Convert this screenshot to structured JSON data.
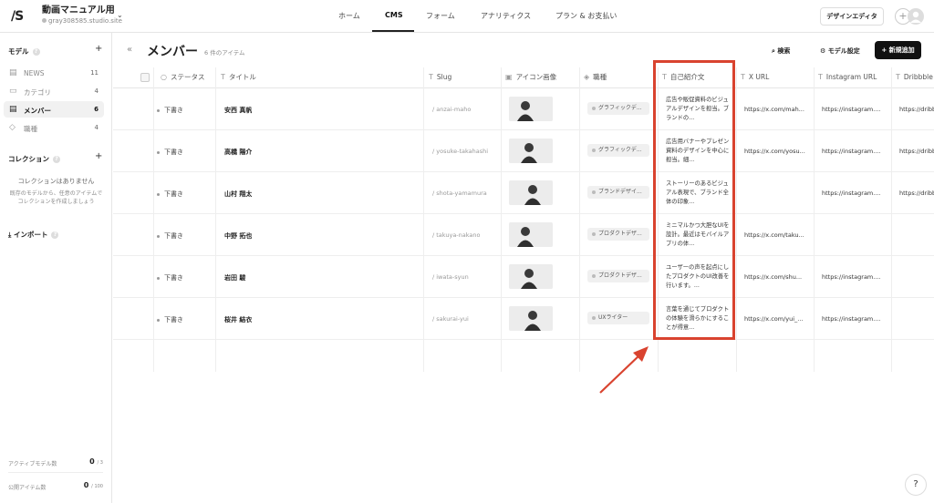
{
  "topbar": {
    "logo": "/S",
    "project_name": "動画マニュアル用",
    "project_site": "gray308585.studio.site",
    "nav": [
      "ホーム",
      "CMS",
      "フォーム",
      "アナリティクス",
      "プラン & お支払い"
    ],
    "design_editor": "デザインエディタ"
  },
  "sidebar": {
    "models_title": "モデル",
    "models": [
      {
        "label": "NEWS",
        "count": "11"
      },
      {
        "label": "カテゴリ",
        "count": "4"
      },
      {
        "label": "メンバー",
        "count": "6"
      },
      {
        "label": "職種",
        "count": "4"
      }
    ],
    "collections_title": "コレクション",
    "collections_empty": "コレクションはありません",
    "collections_desc": "既存のモデルから、任意のアイテムで\nコレクションを作成しましょう",
    "import": "インポート",
    "active_models_label": "アクティブモデル数",
    "active_models_value": "0",
    "active_models_max": "/ 3",
    "public_items_label": "公開アイテム数",
    "public_items_value": "0",
    "public_items_max": "/ 100"
  },
  "main": {
    "title": "メンバー",
    "item_count": "6 件のアイテム",
    "search": "検索",
    "model_settings": "モデル設定",
    "new_item": "新規追加",
    "columns": [
      "ステータス",
      "タイトル",
      "Slug",
      "アイコン画像",
      "職種",
      "自己紹介文",
      "X URL",
      "Instagram URL",
      "Dribbble"
    ],
    "rows": [
      {
        "status": "下書き",
        "title": "安西 真帆",
        "slug": "/ anzai-maho",
        "tag": "グラフィックデ...",
        "intro": "広告や販促資料のビジュアルデザインを担当。ブランドの...",
        "x": "https://x.com/mah...",
        "insta": "https://instagram....",
        "drib": "https://dribb"
      },
      {
        "status": "下書き",
        "title": "高橋 陽介",
        "slug": "/ yosuke-takahashi",
        "tag": "グラフィックデ...",
        "intro": "広告用バナーやプレゼン資料のデザインを中心に担当。細...",
        "x": "https://x.com/yosu...",
        "insta": "https://instagram....",
        "drib": "https://dribb"
      },
      {
        "status": "下書き",
        "title": "山村 翔太",
        "slug": "/ shota-yamamura",
        "tag": "ブランドデザイ...",
        "intro": "ストーリーのあるビジュアル表現で、ブランド全体の印象...",
        "x": "",
        "insta": "https://instagram....",
        "drib": "https://dribb"
      },
      {
        "status": "下書き",
        "title": "中野 拓也",
        "slug": "/ takuya-nakano",
        "tag": "プロダクトデザ...",
        "intro": "ミニマルかつ大胆なUIを設計。最近はモバイルアプリの体...",
        "x": "https://x.com/taku...",
        "insta": "",
        "drib": ""
      },
      {
        "status": "下書き",
        "title": "岩田 駿",
        "slug": "/ iwata-syun",
        "tag": "プロダクトデザ...",
        "intro": "ユーザーの声を起点にしたプロダクトのUI改善を行います。...",
        "x": "https://x.com/shu...",
        "insta": "https://instagram....",
        "drib": ""
      },
      {
        "status": "下書き",
        "title": "桜井 結衣",
        "slug": "/ sakurai-yui",
        "tag": "UXライター",
        "intro": "言葉を通じてプロダクトの体験を滑らかにすることが得意...",
        "x": "https://x.com/yui_...",
        "insta": "https://instagram....",
        "drib": ""
      }
    ]
  },
  "help": "?",
  "colors": {
    "highlight": "#d9432f",
    "accent": "#111111"
  }
}
